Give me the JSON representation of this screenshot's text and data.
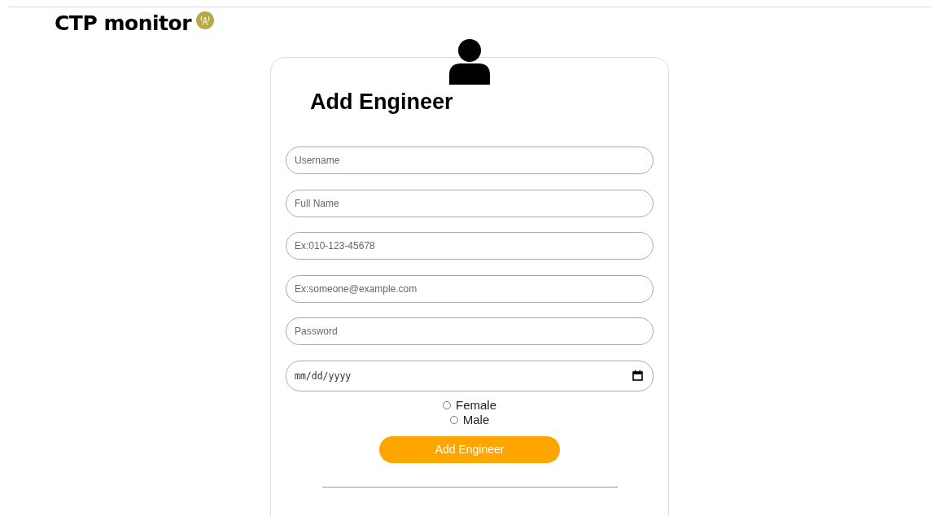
{
  "header": {
    "title": "CTP monitor"
  },
  "form": {
    "title": "Add Engineer",
    "fields": [
      {
        "kind": "text",
        "placeholder": "Username"
      },
      {
        "kind": "text",
        "placeholder": "Full Name"
      },
      {
        "kind": "text",
        "placeholder": "Ex:010-123-45678"
      },
      {
        "kind": "text",
        "placeholder": "Ex:someone@example.com"
      },
      {
        "kind": "password",
        "placeholder": "Password"
      },
      {
        "kind": "date",
        "placeholder": "mm/dd/yyyy"
      }
    ],
    "gender_options": [
      {
        "label": "Female",
        "selected": false
      },
      {
        "label": "Male",
        "selected": false
      }
    ],
    "submit_button": "Add Engineer"
  }
}
